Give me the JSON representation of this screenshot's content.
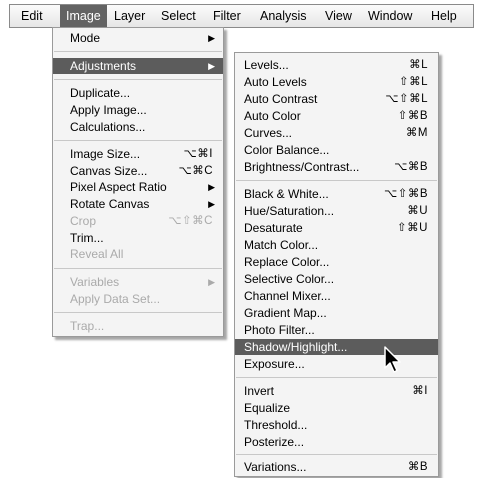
{
  "menubar": {
    "items": [
      "Edit",
      "Image",
      "Layer",
      "Select",
      "Filter",
      "Analysis",
      "View",
      "Window",
      "Help"
    ]
  },
  "image_menu": {
    "mode": "Mode",
    "adjustments": "Adjustments",
    "duplicate": "Duplicate...",
    "apply_image": "Apply Image...",
    "calculations": "Calculations...",
    "image_size": "Image Size...",
    "image_size_sc": "⌥⌘I",
    "canvas_size": "Canvas Size...",
    "canvas_size_sc": "⌥⌘C",
    "pixel_aspect": "Pixel Aspect Ratio",
    "rotate_canvas": "Rotate Canvas",
    "crop": "Crop",
    "crop_sc": "⌥⇧⌘C",
    "trim": "Trim...",
    "reveal_all": "Reveal All",
    "variables": "Variables",
    "apply_data_set": "Apply Data Set...",
    "trap": "Trap..."
  },
  "adjustments_menu": {
    "levels": "Levels...",
    "levels_sc": "⌘L",
    "auto_levels": "Auto Levels",
    "auto_levels_sc": "⇧⌘L",
    "auto_contrast": "Auto Contrast",
    "auto_contrast_sc": "⌥⇧⌘L",
    "auto_color": "Auto Color",
    "auto_color_sc": "⇧⌘B",
    "curves": "Curves...",
    "curves_sc": "⌘M",
    "color_balance": "Color Balance...",
    "brightness_contrast": "Brightness/Contrast...",
    "brightness_contrast_sc": "⌥⌘B",
    "black_white": "Black & White...",
    "black_white_sc": "⌥⇧⌘B",
    "hue_saturation": "Hue/Saturation...",
    "hue_saturation_sc": "⌘U",
    "desaturate": "Desaturate",
    "desaturate_sc": "⇧⌘U",
    "match_color": "Match Color...",
    "replace_color": "Replace Color...",
    "selective_color": "Selective Color...",
    "channel_mixer": "Channel Mixer...",
    "gradient_map": "Gradient Map...",
    "photo_filter": "Photo Filter...",
    "shadow_highlight": "Shadow/Highlight...",
    "exposure": "Exposure...",
    "invert": "Invert",
    "invert_sc": "⌘I",
    "equalize": "Equalize",
    "threshold": "Threshold...",
    "posterize": "Posterize...",
    "variations": "Variations...",
    "variations_sc": "⌘B"
  },
  "icons": {
    "submenu": "submenu-arrow-icon",
    "cursor": "mouse-pointer-icon"
  },
  "colors": {
    "highlight": "#5c5c5c",
    "menu_bg": "#f4f4f4",
    "disabled": "#aaaaaa"
  }
}
